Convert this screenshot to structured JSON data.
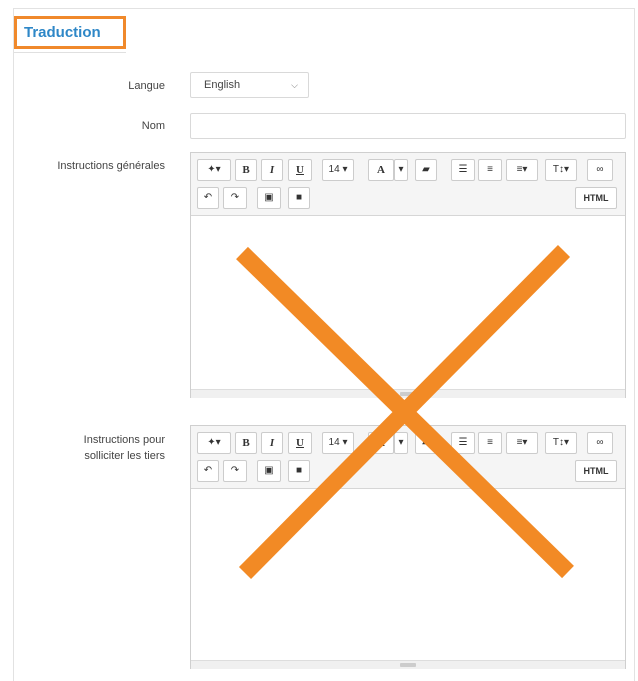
{
  "section": {
    "title": "Traduction"
  },
  "form": {
    "langue_label": "Langue",
    "langue_value": "English",
    "nom_label": "Nom",
    "nom_value": "",
    "instructions_label": "Instructions générales",
    "instructions_tiers_label_line1": "Instructions pour",
    "instructions_tiers_label_line2": "solliciter les tiers"
  },
  "toolbar": {
    "font_size": "14",
    "bold": "B",
    "italic": "I",
    "underline": "U",
    "text_color": "A",
    "html": "HTML"
  },
  "colors": {
    "accent": "#f0892b",
    "title": "#2e87c7",
    "cross": "#f28a25"
  }
}
